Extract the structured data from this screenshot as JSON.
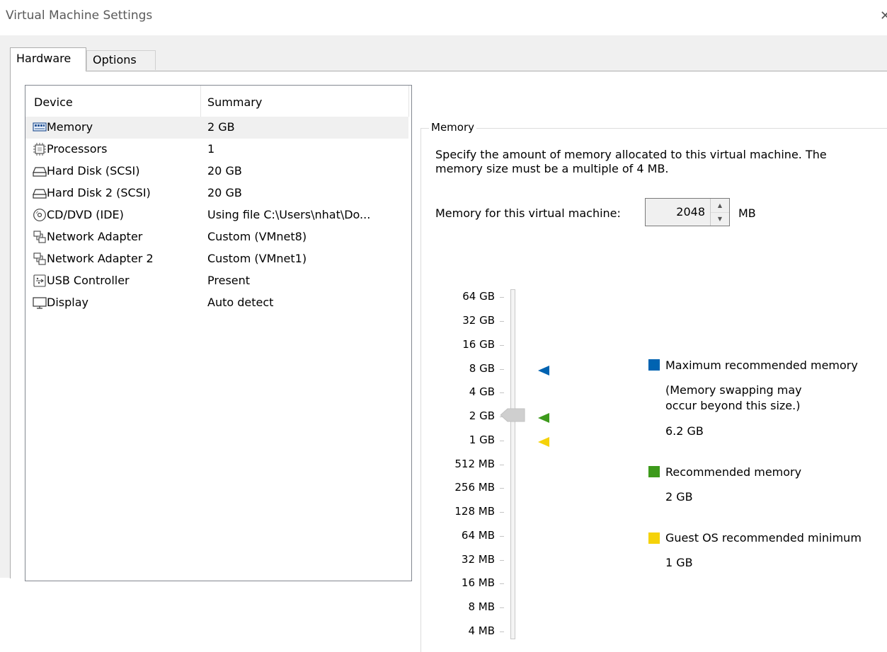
{
  "window": {
    "title": "Virtual Machine Settings"
  },
  "tabs": [
    {
      "label": "Hardware",
      "active": true
    },
    {
      "label": "Options",
      "active": false
    }
  ],
  "device_list": {
    "columns": [
      "Device",
      "Summary"
    ],
    "rows": [
      {
        "device": "Memory",
        "summary": "2 GB",
        "icon": "memory-icon",
        "selected": true
      },
      {
        "device": "Processors",
        "summary": "1",
        "icon": "processor-icon",
        "selected": false
      },
      {
        "device": "Hard Disk (SCSI)",
        "summary": "20 GB",
        "icon": "hard-disk-icon",
        "selected": false
      },
      {
        "device": "Hard Disk 2 (SCSI)",
        "summary": "20 GB",
        "icon": "hard-disk-icon",
        "selected": false
      },
      {
        "device": "CD/DVD (IDE)",
        "summary": "Using file C:\\Users\\nhat\\Do...",
        "icon": "cd-dvd-icon",
        "selected": false
      },
      {
        "device": "Network Adapter",
        "summary": "Custom (VMnet8)",
        "icon": "network-adapter-icon",
        "selected": false
      },
      {
        "device": "Network Adapter 2",
        "summary": "Custom (VMnet1)",
        "icon": "network-adapter-icon",
        "selected": false
      },
      {
        "device": "USB Controller",
        "summary": "Present",
        "icon": "usb-icon",
        "selected": false
      },
      {
        "device": "Display",
        "summary": "Auto detect",
        "icon": "display-icon",
        "selected": false
      }
    ]
  },
  "memory_panel": {
    "group_title": "Memory",
    "description": "Specify the amount of memory allocated to this virtual machine. The memory size must be a multiple of 4 MB.",
    "field_label": "Memory for this virtual machine:",
    "value": "2048",
    "unit": "MB",
    "scale_labels": [
      "64 GB",
      "32 GB",
      "16 GB",
      "8 GB",
      "4 GB",
      "2 GB",
      "1 GB",
      "512 MB",
      "256 MB",
      "128 MB",
      "64 MB",
      "32 MB",
      "16 MB",
      "8 MB",
      "4 MB"
    ],
    "slider_value": "2 GB",
    "legend": [
      {
        "label": "Maximum recommended memory",
        "note": "(Memory swapping may occur beyond this size.)",
        "value": "6.2 GB",
        "color": "#0063b1",
        "marker_level": "8 GB"
      },
      {
        "label": "Recommended memory",
        "note": "",
        "value": "2 GB",
        "color": "#3d9a1b",
        "marker_level": "2 GB"
      },
      {
        "label": "Guest OS recommended minimum",
        "note": "",
        "value": "1 GB",
        "color": "#f5d20a",
        "marker_level": "1 GB"
      }
    ]
  }
}
